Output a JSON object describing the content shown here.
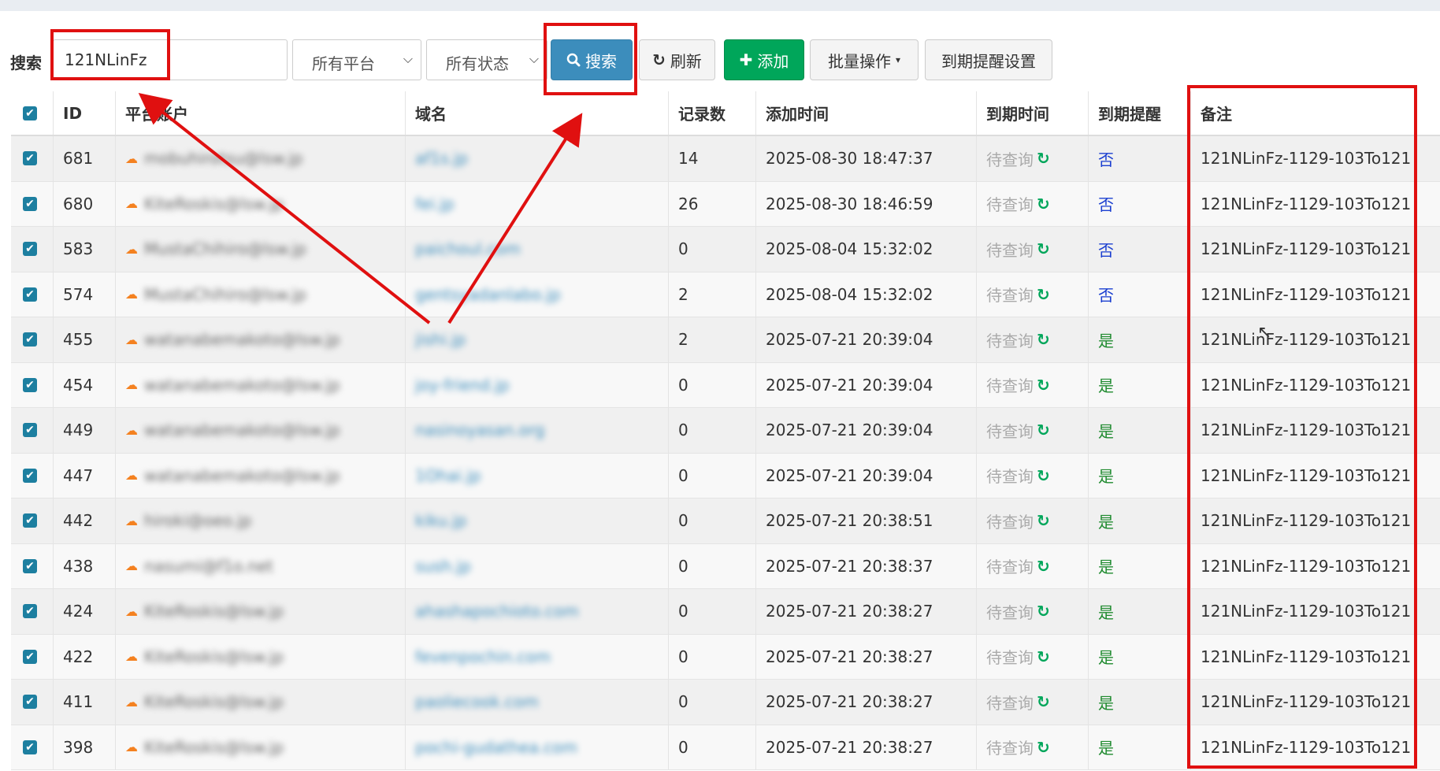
{
  "toolbar": {
    "search_label": "搜索",
    "search_value": "121NLinFz",
    "platform_select": "所有平台",
    "status_select": "所有状态",
    "search_button": "搜索",
    "refresh_button": "刷新",
    "add_button": "添加",
    "batch_button": "批量操作",
    "expire_settings_button": "到期提醒设置"
  },
  "table": {
    "headers": {
      "id": "ID",
      "account": "平台账户",
      "domain": "域名",
      "records": "记录数",
      "added": "添加时间",
      "expire": "到期时间",
      "remind": "到期提醒",
      "note": "备注"
    },
    "rows": [
      {
        "id": "681",
        "account": "mobuhirotsu@lsw.jp",
        "domain": "af1s.jp",
        "records": "14",
        "added": "2025-08-30 18:47:37",
        "expire": "待查询",
        "remind": "否",
        "note": "121NLinFz-1129-103To121"
      },
      {
        "id": "680",
        "account": "KiteRoskis@lsw.jp",
        "domain": "fei.jp",
        "records": "26",
        "added": "2025-08-30 18:46:59",
        "expire": "待查询",
        "remind": "否",
        "note": "121NLinFz-1129-103To121"
      },
      {
        "id": "583",
        "account": "MustaChihiro@lsw.jp",
        "domain": "paichoul.com",
        "records": "0",
        "added": "2025-08-04 15:32:02",
        "expire": "待查询",
        "remind": "否",
        "note": "121NLinFz-1129-103To121"
      },
      {
        "id": "574",
        "account": "MustaChihiro@lsw.jp",
        "domain": "gentsyadanlabo.jp",
        "records": "2",
        "added": "2025-08-04 15:32:02",
        "expire": "待查询",
        "remind": "否",
        "note": "121NLinFz-1129-103To121"
      },
      {
        "id": "455",
        "account": "watanabemakoto@lsw.jp",
        "domain": "jishi.jp",
        "records": "2",
        "added": "2025-07-21 20:39:04",
        "expire": "待查询",
        "remind": "是",
        "note": "121NLinFz-1129-103To121"
      },
      {
        "id": "454",
        "account": "watanabemakoto@lsw.jp",
        "domain": "joy-friend.jp",
        "records": "0",
        "added": "2025-07-21 20:39:04",
        "expire": "待查询",
        "remind": "是",
        "note": "121NLinFz-1129-103To121"
      },
      {
        "id": "449",
        "account": "watanabemakoto@lsw.jp",
        "domain": "nasinoyasan.org",
        "records": "0",
        "added": "2025-07-21 20:39:04",
        "expire": "待查询",
        "remind": "是",
        "note": "121NLinFz-1129-103To121"
      },
      {
        "id": "447",
        "account": "watanabemakoto@lsw.jp",
        "domain": "1Ohai.jp",
        "records": "0",
        "added": "2025-07-21 20:39:04",
        "expire": "待查询",
        "remind": "是",
        "note": "121NLinFz-1129-103To121"
      },
      {
        "id": "442",
        "account": "hiroki@oeo.jp",
        "domain": "kiku.jp",
        "records": "0",
        "added": "2025-07-21 20:38:51",
        "expire": "待查询",
        "remind": "是",
        "note": "121NLinFz-1129-103To121"
      },
      {
        "id": "438",
        "account": "nasumi@f1o.net",
        "domain": "sush.jp",
        "records": "0",
        "added": "2025-07-21 20:38:37",
        "expire": "待查询",
        "remind": "是",
        "note": "121NLinFz-1129-103To121"
      },
      {
        "id": "424",
        "account": "KiteRoskis@lsw.jp",
        "domain": "ahashapochioto.com",
        "records": "0",
        "added": "2025-07-21 20:38:27",
        "expire": "待查询",
        "remind": "是",
        "note": "121NLinFz-1129-103To121"
      },
      {
        "id": "422",
        "account": "KiteRoskis@lsw.jp",
        "domain": "fevenpochin.com",
        "records": "0",
        "added": "2025-07-21 20:38:27",
        "expire": "待查询",
        "remind": "是",
        "note": "121NLinFz-1129-103To121"
      },
      {
        "id": "411",
        "account": "KiteRoskis@lsw.jp",
        "domain": "paoliecook.com",
        "records": "0",
        "added": "2025-07-21 20:38:27",
        "expire": "待查询",
        "remind": "是",
        "note": "121NLinFz-1129-103To121"
      },
      {
        "id": "398",
        "account": "KiteRoskis@lsw.jp",
        "domain": "pochi-gudathea.com",
        "records": "0",
        "added": "2025-07-21 20:38:27",
        "expire": "待查询",
        "remind": "是",
        "note": "121NLinFz-1129-103To121"
      }
    ]
  },
  "colors": {
    "annotation_red": "#e01010",
    "primary_blue": "#3c8dbc",
    "success_green": "#00a65a",
    "no_blue": "#1b3fd0",
    "yes_green": "#1e8a2e",
    "checkbox_teal": "#1d7fa0"
  },
  "icons": {
    "search": "magnifier-icon",
    "refresh": "refresh-icon",
    "add": "plus-icon",
    "cloud": "cloudflare-icon",
    "sync": "sync-icon"
  }
}
